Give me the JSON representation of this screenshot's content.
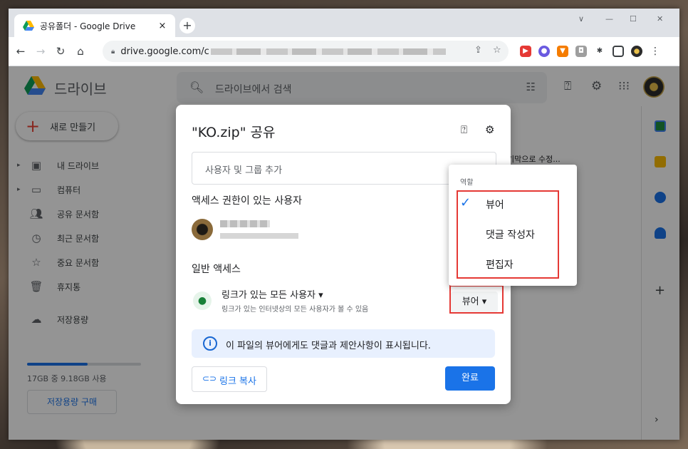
{
  "browser": {
    "tab_title": "공유폴더 - Google Drive",
    "tab_close": "×",
    "new_tab": "+",
    "url": "drive.google.com/c",
    "window_controls": [
      "∨",
      "—",
      "☐",
      "✕"
    ]
  },
  "drive": {
    "app_name": "드라이브",
    "search_placeholder": "드라이브에서 검색",
    "new_button": "새로 만들기",
    "nav": [
      {
        "label": "내 드라이브",
        "icon": "my-drive-icon",
        "caret": "▸"
      },
      {
        "label": "컴퓨터",
        "icon": "computer-icon",
        "caret": "▸"
      },
      {
        "label": "공유 문서함",
        "icon": "shared-icon",
        "caret": ""
      },
      {
        "label": "최근 문서함",
        "icon": "clock-icon",
        "caret": ""
      },
      {
        "label": "중요 문서함",
        "icon": "star-icon",
        "caret": ""
      },
      {
        "label": "휴지통",
        "icon": "trash-icon",
        "caret": ""
      }
    ],
    "storage_label": "저장용량",
    "storage_used_fraction": 0.53,
    "storage_text": "17GB 중 9.18GB 사용",
    "buy_storage": "저장용량 구매",
    "bg_snippet": "기막으로 수정..."
  },
  "share_dialog": {
    "title": "\"KO.zip\" 공유",
    "add_people_placeholder": "사용자 및 그룹 추가",
    "people_with_access_heading": "액세스 권한이 있는 사용자",
    "general_access_heading": "일반 액세스",
    "access_option": "링크가 있는 모든 사용자",
    "access_description": "링크가 있는 인터넷상의 모든 사용자가 볼 수 있음",
    "role_button": "뷰어",
    "info_text": "이 파일의 뷰어에게도 댓글과 제안사항이 표시됩니다.",
    "copy_link": "링크 복사",
    "done": "완료"
  },
  "role_menu": {
    "header": "역할",
    "items": [
      {
        "label": "뷰어",
        "selected": true
      },
      {
        "label": "댓글 작성자",
        "selected": false
      },
      {
        "label": "편집자",
        "selected": false
      }
    ]
  },
  "colors": {
    "accent": "#1a73e8",
    "highlight_box": "#e53935"
  }
}
